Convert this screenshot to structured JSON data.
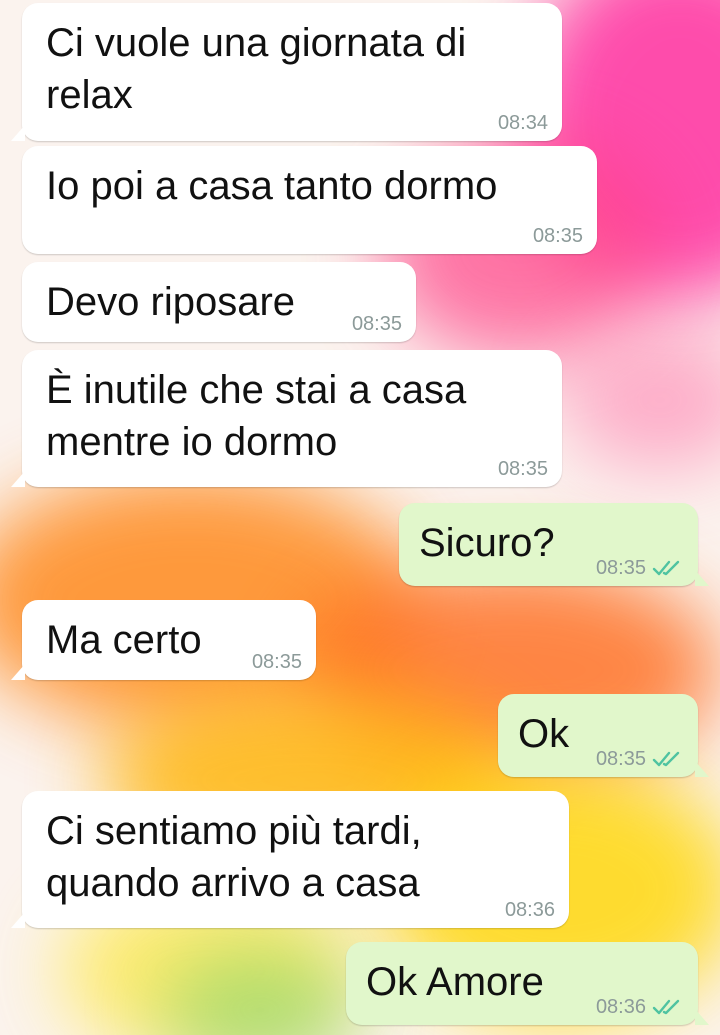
{
  "messages": [
    {
      "text": "Ci vuole una giornata di\nrelax",
      "time": "08:34",
      "direction": "incoming"
    },
    {
      "text": "Io poi a casa tanto dormo",
      "time": "08:35",
      "direction": "incoming"
    },
    {
      "text": "Devo riposare",
      "time": "08:35",
      "direction": "incoming"
    },
    {
      "text": "È inutile che stai a casa\nmentre io dormo",
      "time": "08:35",
      "direction": "incoming"
    },
    {
      "text": "Sicuro?",
      "time": "08:35",
      "direction": "outgoing",
      "status": "read"
    },
    {
      "text": "Ma certo",
      "time": "08:35",
      "direction": "incoming"
    },
    {
      "text": "Ok",
      "time": "08:35",
      "direction": "outgoing",
      "status": "read"
    },
    {
      "text": "Ci sentiamo più tardi,\nquando arrivo a casa",
      "time": "08:36",
      "direction": "incoming"
    },
    {
      "text": "Ok Amore",
      "time": "08:36",
      "direction": "outgoing",
      "status": "read"
    }
  ],
  "colors": {
    "incoming_bubble": "#ffffff",
    "outgoing_bubble": "#e1f7cb",
    "timestamp": "#8c9a99",
    "read_ticks": "#4fc3a1"
  },
  "icons": {
    "read_receipt": "double-check-icon"
  }
}
